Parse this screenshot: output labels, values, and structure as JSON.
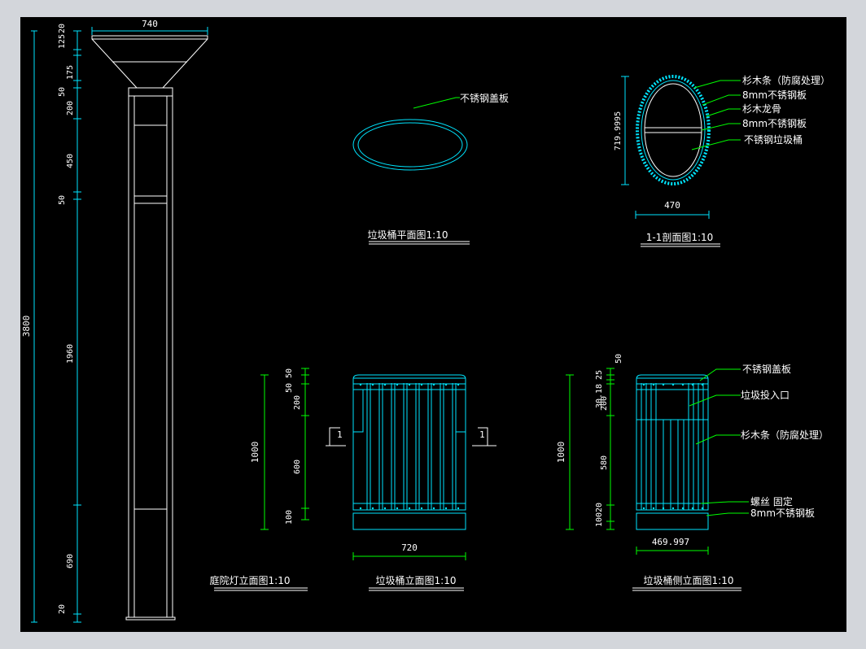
{
  "colors": {
    "background": "#000000",
    "frame": "#d3d6db",
    "geometry": "#00e5ff",
    "dimension": "#00ff00",
    "label": "#ffffff"
  },
  "lamp": {
    "title": "庭院灯立面图1:10",
    "dims": {
      "top_width": "740",
      "total_height": "3800",
      "segments": [
        "125",
        "20",
        "175",
        "50",
        "200",
        "450",
        "50",
        "1960",
        "690",
        "20"
      ]
    }
  },
  "plan": {
    "title": "垃圾桶平面图1:10",
    "callout": "不锈钢盖板"
  },
  "section": {
    "title": "1-1剖面图1:10",
    "height_dim": "719.9995",
    "width_dim": "470",
    "callouts": [
      "杉木条（防腐处理）",
      "8mm不锈钢板",
      "杉木龙骨",
      "8mm不锈钢板",
      "不锈钢垃圾桶"
    ]
  },
  "front": {
    "title": "垃圾桶立面图1:10",
    "width_dim": "720",
    "height_dim": "1000",
    "segments": [
      "50",
      "50",
      "200",
      "600",
      "100"
    ],
    "section_mark": "1"
  },
  "side": {
    "title": "垃圾桶侧立面图1:10",
    "width_dim": "469.997",
    "height_dim": "1000",
    "segments": [
      "50",
      "30.18",
      "25",
      "200",
      "580",
      "100",
      "20"
    ],
    "callouts": [
      "不锈钢盖板",
      "垃圾投入口",
      "杉木条（防腐处理）",
      "螺丝 固定",
      "8mm不锈钢板"
    ]
  }
}
